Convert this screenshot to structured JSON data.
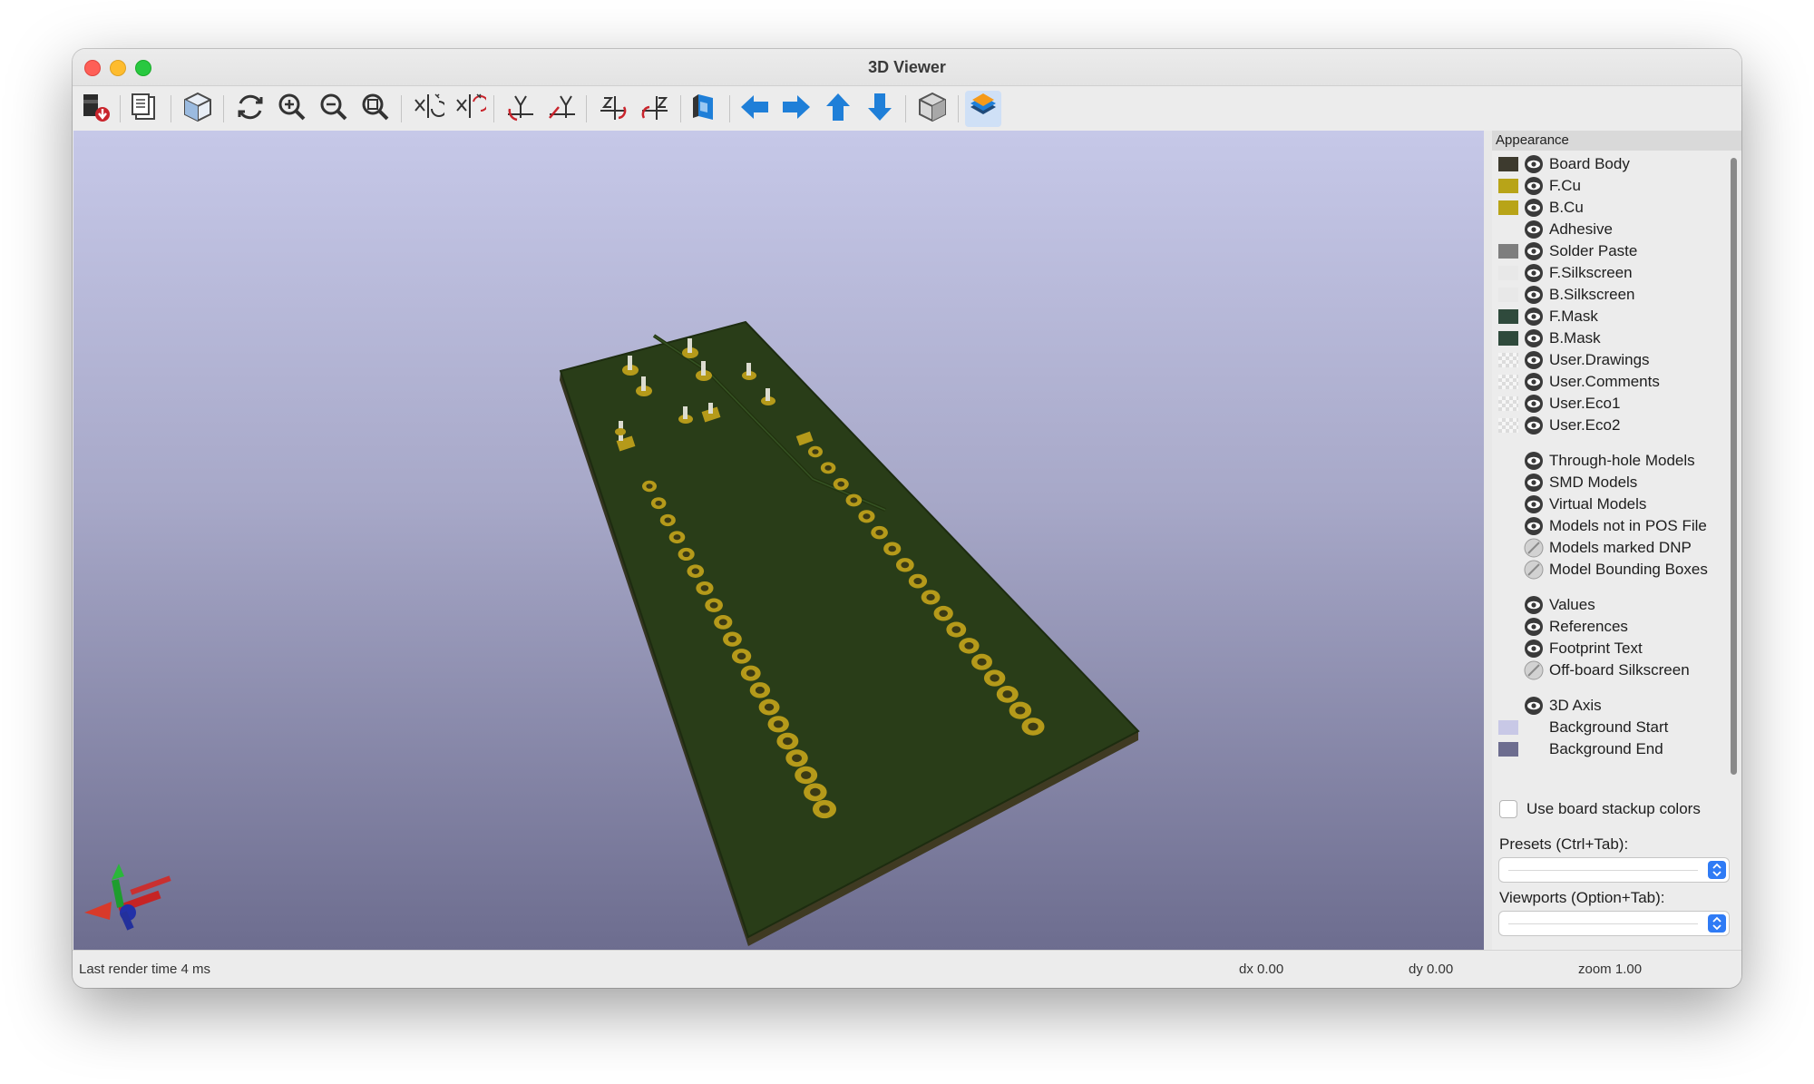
{
  "window": {
    "title": "3D Viewer"
  },
  "toolbar": {
    "buttons": [
      {
        "name": "export-image-button",
        "icon": "export-icon"
      },
      {
        "name": "copy-to-clipboard-button",
        "icon": "clipboard-icon"
      },
      {
        "name": "raytracing-toggle-button",
        "icon": "raytrace-icon"
      },
      {
        "name": "reload-board-button",
        "icon": "refresh-icon"
      },
      {
        "name": "zoom-in-button",
        "icon": "zoom-in-icon"
      },
      {
        "name": "zoom-out-button",
        "icon": "zoom-out-icon"
      },
      {
        "name": "zoom-fit-button",
        "icon": "zoom-fit-icon"
      },
      {
        "name": "rotate-x-cw-button",
        "icon": "rotate-x-cw-icon"
      },
      {
        "name": "rotate-x-ccw-button",
        "icon": "rotate-x-ccw-icon"
      },
      {
        "name": "rotate-y-cw-button",
        "icon": "rotate-y-cw-icon"
      },
      {
        "name": "rotate-y-ccw-button",
        "icon": "rotate-y-ccw-icon"
      },
      {
        "name": "rotate-z-cw-button",
        "icon": "rotate-z-cw-icon"
      },
      {
        "name": "rotate-z-ccw-button",
        "icon": "rotate-z-ccw-icon"
      },
      {
        "name": "flip-board-button",
        "icon": "flip-icon"
      },
      {
        "name": "move-left-button",
        "icon": "arrow-left-icon"
      },
      {
        "name": "move-right-button",
        "icon": "arrow-right-icon"
      },
      {
        "name": "move-up-button",
        "icon": "arrow-up-icon"
      },
      {
        "name": "move-down-button",
        "icon": "arrow-down-icon"
      },
      {
        "name": "orthographic-toggle-button",
        "icon": "ortho-cube-icon"
      },
      {
        "name": "appearance-panel-toggle-button",
        "icon": "layers-icon"
      }
    ]
  },
  "appearance": {
    "header": "Appearance",
    "layers": [
      {
        "label": "Board Body",
        "color": "#3d3a2e",
        "swatch": "solid",
        "visible": true
      },
      {
        "label": "F.Cu",
        "color": "#b8a418",
        "swatch": "solid",
        "visible": true
      },
      {
        "label": "B.Cu",
        "color": "#b8a418",
        "swatch": "solid",
        "visible": true
      },
      {
        "label": "Adhesive",
        "color": "",
        "swatch": "none",
        "visible": true
      },
      {
        "label": "Solder Paste",
        "color": "#7e7e7e",
        "swatch": "solid",
        "visible": true
      },
      {
        "label": "F.Silkscreen",
        "color": "#e8e8e8",
        "swatch": "solid",
        "visible": true
      },
      {
        "label": "B.Silkscreen",
        "color": "#e8e8e8",
        "swatch": "solid",
        "visible": true
      },
      {
        "label": "F.Mask",
        "color": "#2f4a3c",
        "swatch": "solid",
        "visible": true
      },
      {
        "label": "B.Mask",
        "color": "#2f4a3c",
        "swatch": "solid",
        "visible": true
      },
      {
        "label": "User.Drawings",
        "color": "",
        "swatch": "checker",
        "visible": true
      },
      {
        "label": "User.Comments",
        "color": "",
        "swatch": "checker",
        "visible": true
      },
      {
        "label": "User.Eco1",
        "color": "",
        "swatch": "checker",
        "visible": true
      },
      {
        "label": "User.Eco2",
        "color": "",
        "swatch": "checker",
        "visible": true
      }
    ],
    "models": [
      {
        "label": "Through-hole Models",
        "visible": true
      },
      {
        "label": "SMD Models",
        "visible": true
      },
      {
        "label": "Virtual Models",
        "visible": true
      },
      {
        "label": "Models not in POS File",
        "visible": true
      },
      {
        "label": "Models marked DNP",
        "visible": false
      },
      {
        "label": "Model Bounding Boxes",
        "visible": false
      }
    ],
    "texts": [
      {
        "label": "Values",
        "visible": true
      },
      {
        "label": "References",
        "visible": true
      },
      {
        "label": "Footprint Text",
        "visible": true
      },
      {
        "label": "Off-board Silkscreen",
        "visible": false
      }
    ],
    "environment": [
      {
        "label": "3D Axis",
        "color": "",
        "swatch": "none",
        "visible": true
      },
      {
        "label": "Background Start",
        "color": "#c8c8e6",
        "swatch": "solid",
        "visible": null
      },
      {
        "label": "Background End",
        "color": "#6d6d8f",
        "swatch": "solid",
        "visible": null
      }
    ],
    "use_stackup_label": "Use board stackup colors",
    "use_stackup_checked": false,
    "presets_label": "Presets (Ctrl+Tab):",
    "presets_value": "",
    "viewports_label": "Viewports (Option+Tab):",
    "viewports_value": ""
  },
  "statusbar": {
    "render_time": "Last render time 4 ms",
    "dx": "dx 0.00",
    "dy": "dy 0.00",
    "zoom": "zoom 1.00"
  },
  "colors": {
    "accent": "#2f7bf5",
    "toolbar_arrow": "#1f7fd8",
    "board_mask": "#293d18",
    "copper": "#b59a1a",
    "background_start": "#c6c8e8",
    "background_end": "#6d6d8f"
  }
}
